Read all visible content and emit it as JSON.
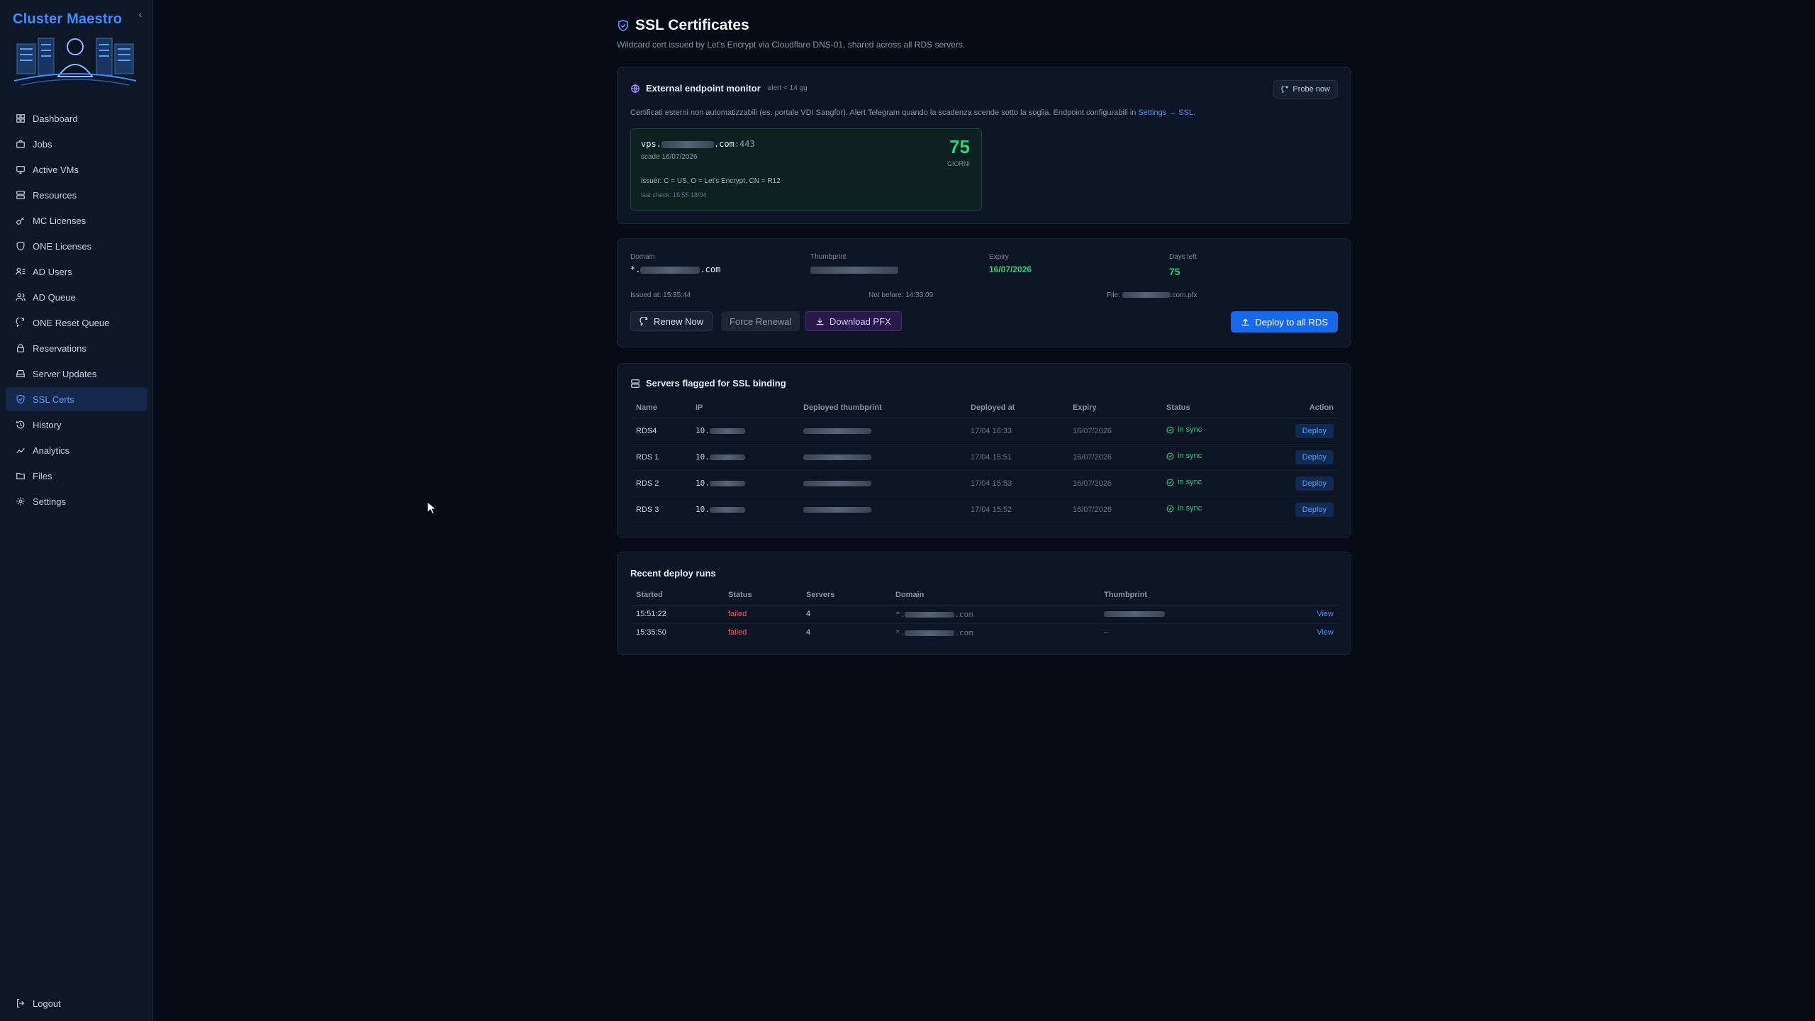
{
  "app": {
    "brand": "Cluster Maestro",
    "collapse_icon": "‹"
  },
  "sidebar": {
    "items": [
      {
        "label": "Dashboard",
        "icon": "dashboard-icon"
      },
      {
        "label": "Jobs",
        "icon": "briefcase-icon"
      },
      {
        "label": "Active VMs",
        "icon": "monitor-icon"
      },
      {
        "label": "Resources",
        "icon": "server-icon"
      },
      {
        "label": "MC Licenses",
        "icon": "key-icon"
      },
      {
        "label": "ONE Licenses",
        "icon": "shield-icon"
      },
      {
        "label": "AD Users",
        "icon": "users-list-icon"
      },
      {
        "label": "AD Queue",
        "icon": "user-queue-icon"
      },
      {
        "label": "ONE Reset Queue",
        "icon": "refresh-icon"
      },
      {
        "label": "Reservations",
        "icon": "lock-icon"
      },
      {
        "label": "Server Updates",
        "icon": "drive-icon"
      },
      {
        "label": "SSL Certs",
        "icon": "shield-check-icon",
        "active": true
      },
      {
        "label": "History",
        "icon": "history-icon"
      },
      {
        "label": "Analytics",
        "icon": "chart-icon"
      },
      {
        "label": "Files",
        "icon": "folder-icon"
      },
      {
        "label": "Settings",
        "icon": "gear-icon"
      }
    ],
    "logout": "Logout"
  },
  "page": {
    "title": "SSL Certificates",
    "subtitle": "Wildcard cert issued by Let's Encrypt via Cloudflare DNS-01, shared across all RDS servers."
  },
  "monitor": {
    "title": "External endpoint monitor",
    "alert": "alert < 14 gg",
    "probe_label": "Probe now",
    "description": "Certificati esterni non automatizzabili (es. portale VDI Sangfor). Alert Telegram quando la scadenza scende sotto la soglia. Endpoint configurabili in",
    "description_link": "Settings → SSL",
    "description_end": ".",
    "endpoint": {
      "host_prefix": "vps.",
      "host_suffix": ".com",
      "port": ":443",
      "expiry": "scade 16/07/2026",
      "issuer": "issuer: C = US, O = Let's Encrypt, CN = R12",
      "last_check": "last check: 15:55 18/04",
      "days": "75",
      "days_unit": "GIORNI"
    }
  },
  "cert": {
    "domain_label": "Domain",
    "domain_prefix": "*.",
    "domain_suffix": ".com",
    "thumbprint_label": "Thumbprint",
    "expiry_label": "Expiry",
    "expiry": "16/07/2026",
    "days_label": "Days left",
    "days": "75",
    "issued": "Issued at: 15:35:44",
    "not_before": "Not before: 14:33:09",
    "file_prefix": "File:",
    "file_suffix": ".com.pfx",
    "renew_label": "Renew Now",
    "force_label": "Force Renewal",
    "download_label": "Download PFX",
    "deploy_all_label": "Deploy to all RDS"
  },
  "servers": {
    "title": "Servers flagged for SSL binding",
    "columns": [
      "Name",
      "IP",
      "Deployed thumbprint",
      "Deployed at",
      "Expiry",
      "Status",
      "Action"
    ],
    "rows": [
      {
        "name": "RDS4",
        "ip": "10.",
        "deployed_at": "17/04 16:33",
        "expiry": "16/07/2026",
        "status": "in sync",
        "action": "Deploy"
      },
      {
        "name": "RDS 1",
        "ip": "10.",
        "deployed_at": "17/04 15:51",
        "expiry": "16/07/2026",
        "status": "in sync",
        "action": "Deploy"
      },
      {
        "name": "RDS 2",
        "ip": "10.",
        "deployed_at": "17/04 15:53",
        "expiry": "16/07/2026",
        "status": "in sync",
        "action": "Deploy"
      },
      {
        "name": "RDS 3",
        "ip": "10.",
        "deployed_at": "17/04 15:52",
        "expiry": "16/07/2026",
        "status": "in sync",
        "action": "Deploy"
      }
    ]
  },
  "runs": {
    "title": "Recent deploy runs",
    "columns": [
      "Started",
      "Status",
      "Servers",
      "Domain",
      "Thumbprint",
      ""
    ],
    "rows": [
      {
        "started": "15:51:22",
        "status": "failed",
        "servers": "4",
        "domain_prefix": "*.",
        "domain_suffix": ".com",
        "thumbprint": "",
        "action": "View"
      },
      {
        "started": "15:35:50",
        "status": "failed",
        "servers": "4",
        "domain_prefix": "*.",
        "domain_suffix": ".com",
        "thumbprint": "–",
        "action": "View"
      }
    ]
  },
  "colors": {
    "accent": "#3f8cff",
    "success": "#31d07a",
    "danger": "#ff5a5a",
    "background": "#060b16",
    "sidebar": "#0f1828"
  }
}
